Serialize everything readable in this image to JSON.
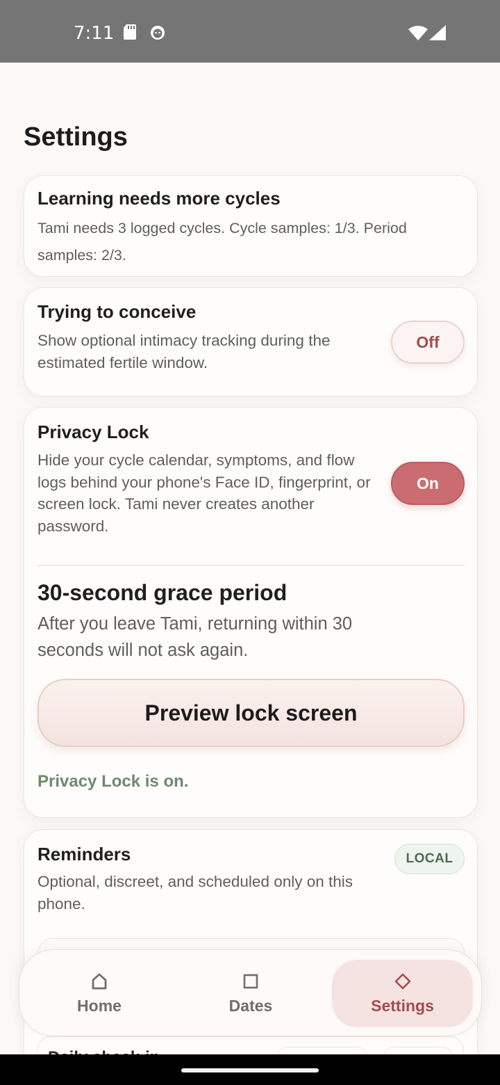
{
  "status_bar": {
    "time": "7:11",
    "icons": [
      "sd-card-icon",
      "cat-face-icon",
      "wifi-icon",
      "signal-icon"
    ]
  },
  "page": {
    "title": "Settings"
  },
  "learning_card": {
    "title": "Learning needs more cycles",
    "description": "Tami needs 3 logged cycles. Cycle samples: 1/3. Period samples: 2/3."
  },
  "conceive_card": {
    "title": "Trying to conceive",
    "description": "Show optional intimacy tracking during the estimated fertile window.",
    "toggle_label": "Off",
    "toggle_state": "off"
  },
  "privacy_card": {
    "title": "Privacy Lock",
    "description": "Hide your cycle calendar, symptoms, and flow logs behind your phone's Face ID, fingerprint, or screen lock. Tami never creates another password.",
    "toggle_label": "On",
    "toggle_state": "on",
    "grace_title": "30-second grace period",
    "grace_description": "After you leave Tami, returning within 30 seconds will not ask again.",
    "preview_button": "Preview lock screen",
    "status_text": "Privacy Lock is on."
  },
  "reminders_card": {
    "title": "Reminders",
    "description": "Optional, discreet, and scheduled only on this phone.",
    "badge": "LOCAL",
    "peek_item": "Daily check-in"
  },
  "bottom_nav": {
    "items": [
      {
        "label": "Home",
        "icon": "home-icon",
        "active": false
      },
      {
        "label": "Dates",
        "icon": "square-icon",
        "active": false
      },
      {
        "label": "Settings",
        "icon": "diamond-icon",
        "active": true
      }
    ]
  },
  "colors": {
    "accent": "#cb6d70",
    "accent_text": "#a34c4e",
    "success_text": "#6c8a6f",
    "background": "#fbf8f6"
  }
}
